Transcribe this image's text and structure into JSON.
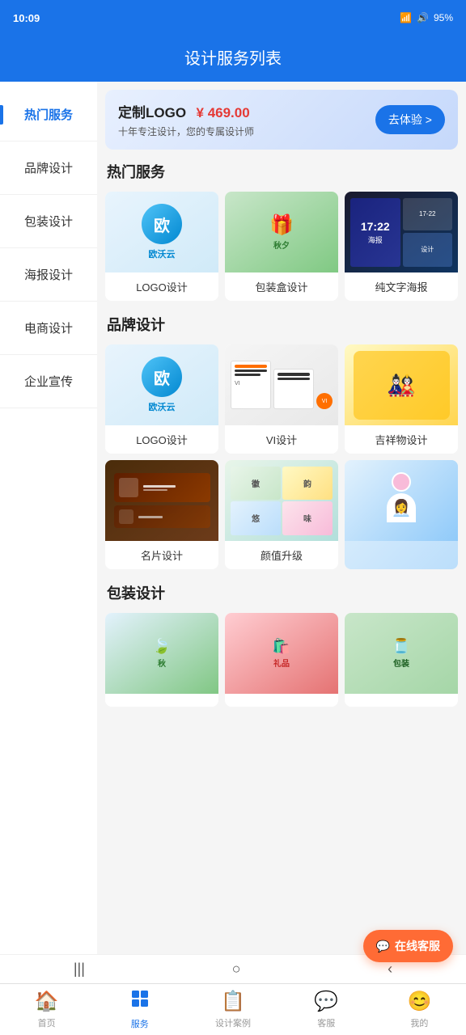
{
  "app": {
    "title": "设计服务列表"
  },
  "statusBar": {
    "time": "10:09",
    "battery": "95%"
  },
  "banner": {
    "title": "定制LOGO",
    "price": "¥ 469.00",
    "subtitle": "十年专注设计，您的专属设计师",
    "buttonLabel": "去体验 >"
  },
  "sidebar": {
    "items": [
      {
        "id": "hot",
        "label": "热门服务",
        "active": true
      },
      {
        "id": "brand",
        "label": "品牌设计",
        "active": false
      },
      {
        "id": "package",
        "label": "包装设计",
        "active": false
      },
      {
        "id": "poster",
        "label": "海报设计",
        "active": false
      },
      {
        "id": "ecommerce",
        "label": "电商设计",
        "active": false
      },
      {
        "id": "corporate",
        "label": "企业宣传",
        "active": false
      }
    ]
  },
  "sections": [
    {
      "id": "hot",
      "title": "热门服务",
      "products": [
        {
          "id": "logo1",
          "label": "LOGO设计",
          "thumbType": "logo-design"
        },
        {
          "id": "pkg1",
          "label": "包装盒设计",
          "thumbType": "package-design"
        },
        {
          "id": "poster1",
          "label": "纯文字海报",
          "thumbType": "poster-design"
        }
      ]
    },
    {
      "id": "brand",
      "title": "品牌设计",
      "products": [
        {
          "id": "logo2",
          "label": "LOGO设计",
          "thumbType": "logo-design2"
        },
        {
          "id": "vi1",
          "label": "VI设计",
          "thumbType": "vi-design"
        },
        {
          "id": "mascot1",
          "label": "吉祥物设计",
          "thumbType": "mascot-design"
        },
        {
          "id": "card1",
          "label": "名片设计",
          "thumbType": "card-design"
        },
        {
          "id": "brand1",
          "label": "颜值升级",
          "thumbType": "brand-upgrade"
        },
        {
          "id": "advisor",
          "label": "",
          "thumbType": "advisor"
        }
      ]
    },
    {
      "id": "package",
      "title": "包装设计",
      "products": [
        {
          "id": "pkg2",
          "label": "",
          "thumbType": "pkg-green"
        },
        {
          "id": "pkg3",
          "label": "",
          "thumbType": "pkg-red"
        },
        {
          "id": "pkg4",
          "label": "",
          "thumbType": "pkg-light"
        }
      ]
    }
  ],
  "bottomNav": {
    "items": [
      {
        "id": "home",
        "label": "首页",
        "icon": "🏠",
        "active": false
      },
      {
        "id": "service",
        "label": "服务",
        "icon": "⊞",
        "active": true
      },
      {
        "id": "cases",
        "label": "设计案例",
        "icon": "📋",
        "active": false
      },
      {
        "id": "customer",
        "label": "客服",
        "icon": "💬",
        "active": false
      },
      {
        "id": "mine",
        "label": "我的",
        "icon": "☺",
        "active": false
      }
    ]
  },
  "floatService": {
    "label": "在线客服"
  }
}
